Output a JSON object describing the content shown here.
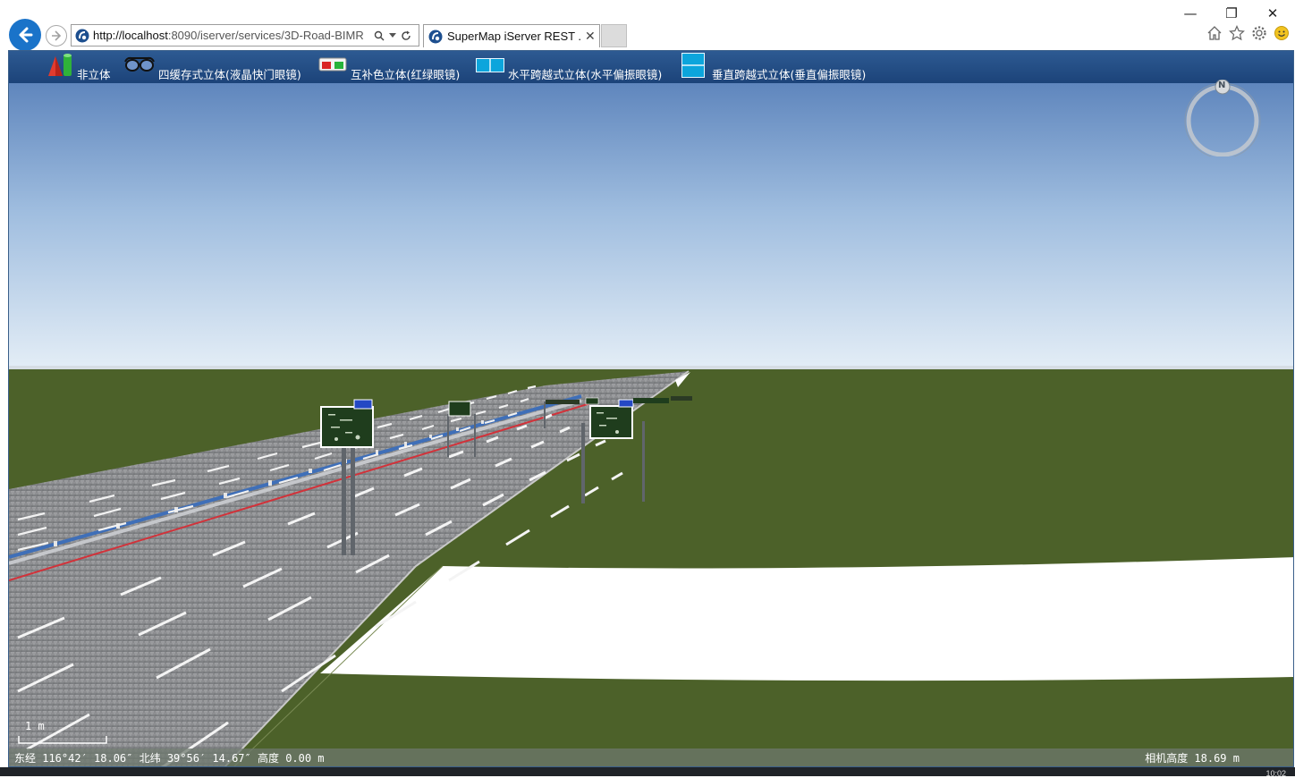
{
  "browser": {
    "url_host": "http://localhost",
    "url_rest": ":8090/iserver/services/3D-Road-BIMR",
    "tab_title": "SuperMap iServer REST ...",
    "tab_close": "✕",
    "window_controls": {
      "minimize": "—",
      "restore": "❐",
      "close": "✕"
    }
  },
  "toolbar": {
    "items": [
      {
        "label": "非立体",
        "icon": "cone-cylinder-icon"
      },
      {
        "label": "四缓存式立体(液晶快门眼镜)",
        "icon": "shutter-glasses-icon"
      },
      {
        "label": "互补色立体(红绿眼镜)",
        "icon": "anaglyph-glasses-icon"
      },
      {
        "label": "水平跨越式立体(水平偏振眼镜)",
        "icon": "side-by-side-icon"
      },
      {
        "label": "垂直跨越式立体(垂直偏振眼镜)",
        "icon": "top-bottom-icon"
      }
    ]
  },
  "compass": {
    "north_label": "N"
  },
  "scale": {
    "label": "1 m"
  },
  "status": {
    "coords": "东经 116°42′ 18.06″  北纬 39°56′ 14.67″  高度 0.00 m",
    "camera_height": "相机高度 18.69 m"
  },
  "taskbar": {
    "clock": "10:02"
  },
  "colors": {
    "toolbar": "#244f87",
    "grass": "#4c6129",
    "road": "#8a8a8c",
    "sky_top": "#5f86bd",
    "sky_bottom": "#dfe9f4"
  }
}
